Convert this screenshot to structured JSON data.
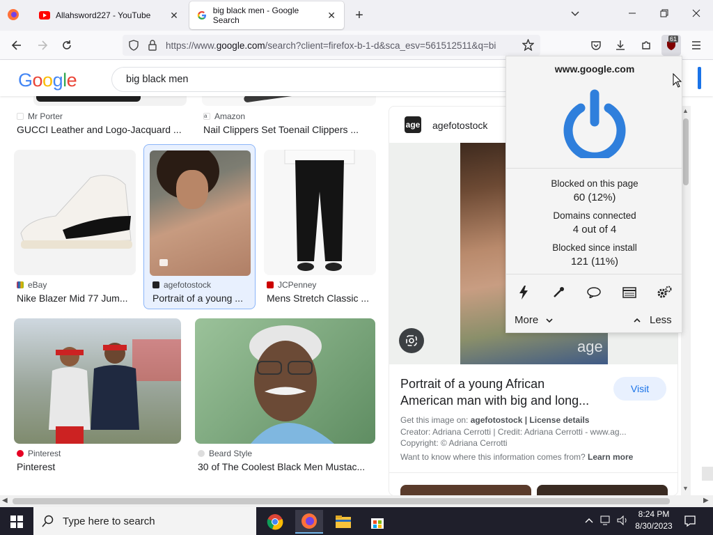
{
  "tabs": [
    {
      "title": "Allahsword227 - YouTube",
      "close": "✕"
    },
    {
      "title": "big black men - Google Search",
      "close": "✕"
    }
  ],
  "new_tab": "+",
  "toolbar": {
    "url_prefix": "https://www.",
    "url_domain": "google.com",
    "url_rest": "/search?client=firefox-b-1-d&sca_esv=561512511&q=bi",
    "ext_badge": "61"
  },
  "google": {
    "logo_letters": [
      "G",
      "o",
      "o",
      "g",
      "l",
      "e"
    ],
    "logo_colors": [
      "#4285f4",
      "#ea4335",
      "#fbbc05",
      "#4285f4",
      "#34a853",
      "#ea4335"
    ],
    "query": "big black men"
  },
  "results": [
    {
      "source": "Mr Porter",
      "title": "GUCCI Leather and Logo-Jacquard ..."
    },
    {
      "source": "Amazon",
      "title": "Nail Clippers Set Toenail Clippers ..."
    },
    {
      "source": "eBay",
      "title": "Nike Blazer Mid 77 Jum..."
    },
    {
      "source": "agefotostock",
      "title": "Portrait of a young ..."
    },
    {
      "source": "JCPenney",
      "title": "Mens Stretch Classic ..."
    },
    {
      "source": "Pinterest",
      "title": "Pinterest"
    },
    {
      "source": "Beard Style",
      "title": "30 of The Coolest Black Men Mustac..."
    }
  ],
  "preview": {
    "source": "agefotostock",
    "logo_text": "age",
    "watermark": "age",
    "title_line1": "Portrait of a young African",
    "title_line2": "American man with big and long...",
    "visit": "Visit",
    "get_image_prefix": "Get this image on: ",
    "get_image_source": "agefotostock | License details",
    "creator": "Creator: Adriana Cerrotti | Credit: Adriana Cerrotti - www.ag...",
    "copyright": "Copyright: © Adriana Cerrotti",
    "info_prefix": "Want to know where this information comes from? ",
    "learn_more": "Learn more"
  },
  "popup": {
    "domain": "www.google.com",
    "blocked_page_label": "Blocked on this page",
    "blocked_page_value": "60 (12%)",
    "domains_label": "Domains connected",
    "domains_value": "4 out of 4",
    "blocked_install_label": "Blocked since install",
    "blocked_install_value": "121 (11%)",
    "more": "More",
    "less": "Less",
    "accent": "#2f7fdc"
  },
  "taskbar": {
    "search_placeholder": "Type here to search",
    "time": "8:24 PM",
    "date": "8/30/2023"
  }
}
